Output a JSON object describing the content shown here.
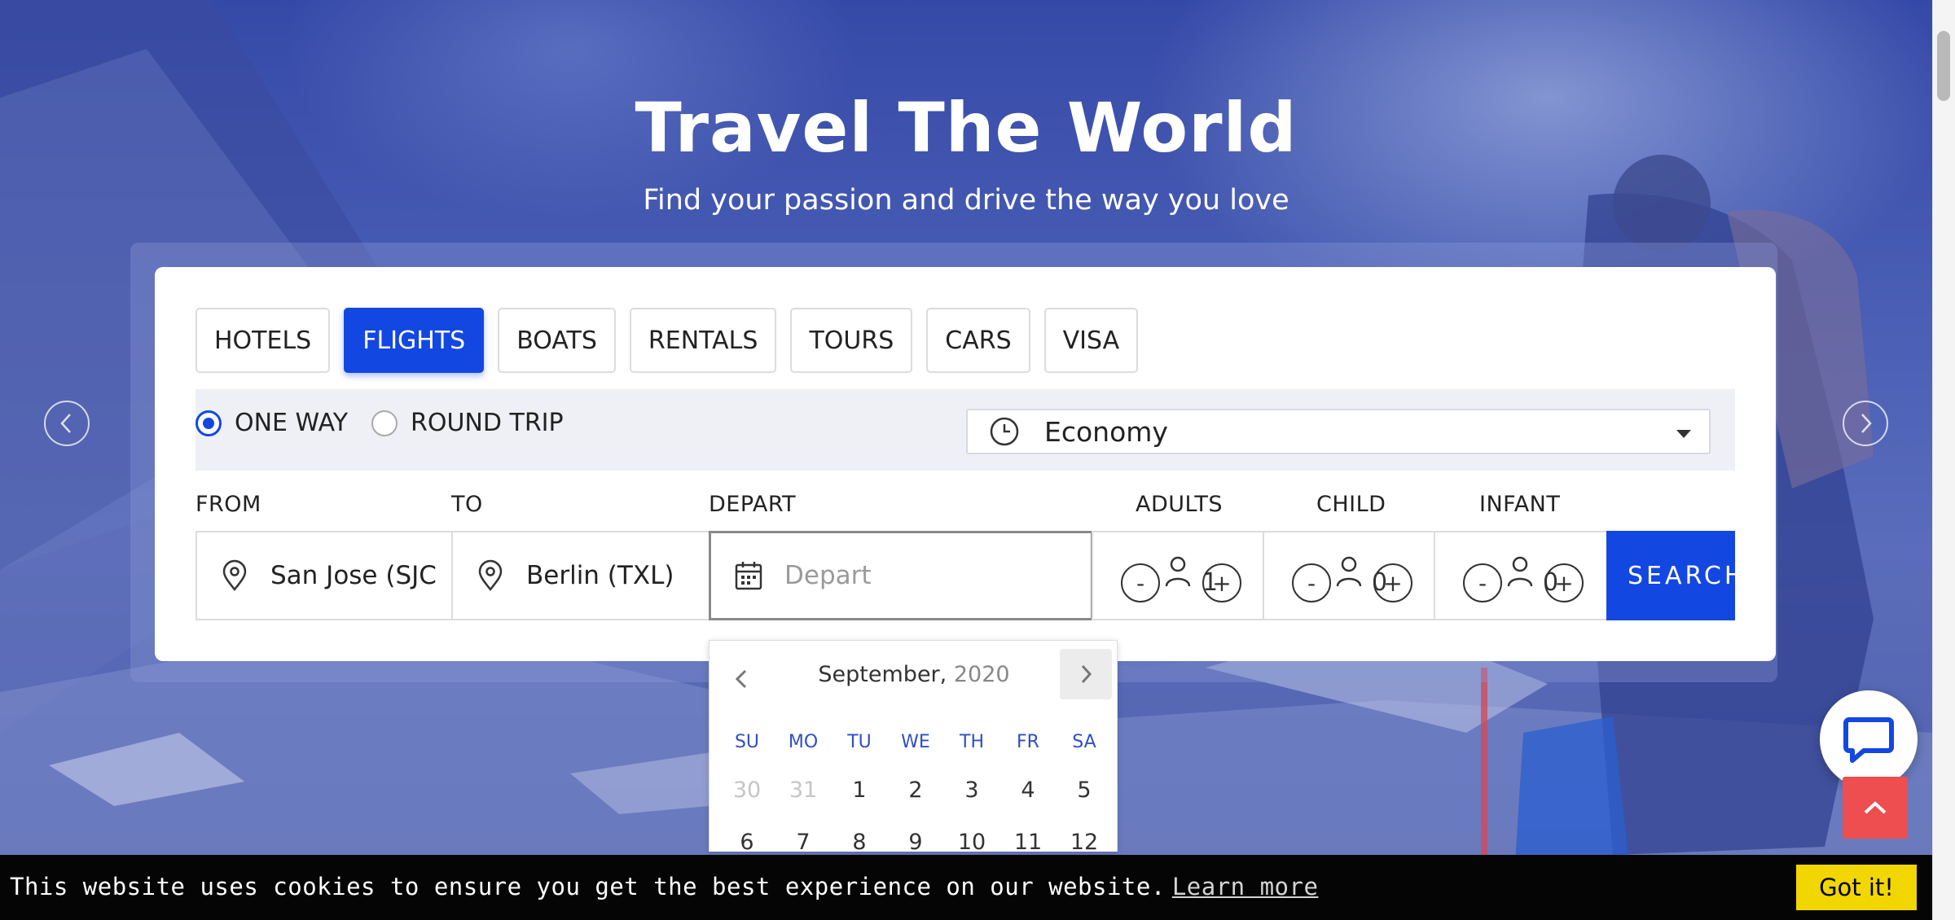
{
  "hero": {
    "title": "Travel The World",
    "subtitle": "Find your passion and drive the way you love"
  },
  "tabs": [
    {
      "label": "HOTELS",
      "active": false
    },
    {
      "label": "FLIGHTS",
      "active": true
    },
    {
      "label": "BOATS",
      "active": false
    },
    {
      "label": "RENTALS",
      "active": false
    },
    {
      "label": "TOURS",
      "active": false
    },
    {
      "label": "CARS",
      "active": false
    },
    {
      "label": "VISA",
      "active": false
    }
  ],
  "trip_type": {
    "one_way": "ONE WAY",
    "round_trip": "ROUND TRIP",
    "selected": "ONE WAY"
  },
  "cabin_class": {
    "value": "Economy",
    "icon": "clock-icon"
  },
  "labels": {
    "from": "FROM",
    "to": "TO",
    "depart": "DEPART",
    "adults": "ADULTS",
    "child": "CHILD",
    "infant": "INFANT"
  },
  "fields": {
    "from_value": "San Jose (SJC",
    "to_value": "Berlin (TXL)",
    "depart_placeholder": "Depart"
  },
  "counters": {
    "minus": "-",
    "plus": "+",
    "adults": "1",
    "child": "0",
    "infant": "0"
  },
  "search_label": "SEARCH",
  "calendar": {
    "month": "September,",
    "year": "2020",
    "weekdays": [
      "SU",
      "MO",
      "TU",
      "WE",
      "TH",
      "FR",
      "SA"
    ],
    "week1": [
      "30",
      "31",
      "1",
      "2",
      "3",
      "4",
      "5"
    ],
    "week2": [
      "6",
      "7",
      "8",
      "9",
      "10",
      "11",
      "12"
    ],
    "muted_days": [
      "30",
      "31"
    ]
  },
  "cookie_banner": {
    "message": "This website uses cookies to ensure you get the best experience on our website.",
    "learn_more": "Learn more",
    "accept": "Got it!"
  },
  "colors": {
    "accent": "#1347e2",
    "to_top": "#ee4e4f",
    "cookie_button": "#f1d600"
  }
}
